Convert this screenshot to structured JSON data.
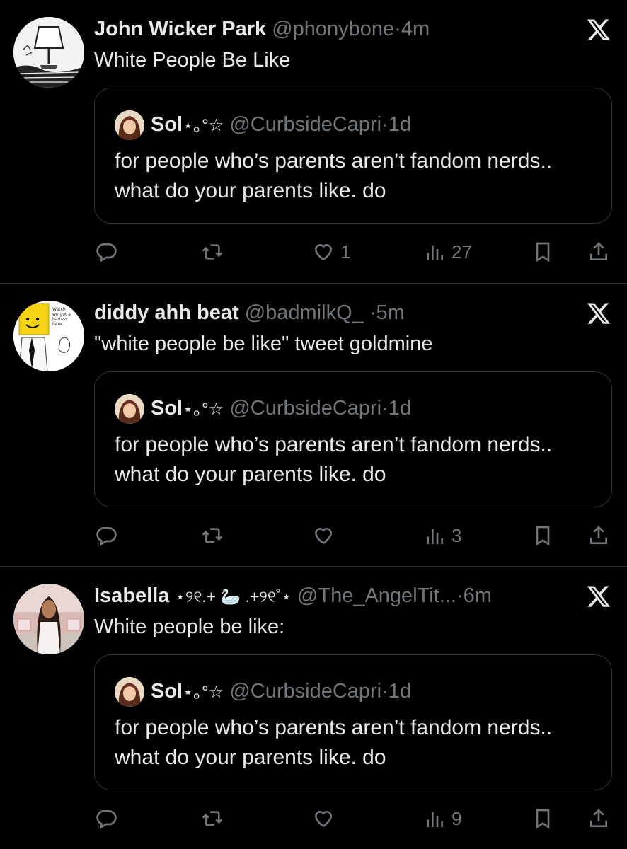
{
  "quoted": {
    "name": "Sol",
    "decoration": "⋆｡°☆",
    "handle": "@CurbsideCapri",
    "separator": "·",
    "time": "1d",
    "text": "for people who’s parents aren’t fandom nerds.. what do your parents like. do"
  },
  "tweets": [
    {
      "name": "John Wicker Park",
      "decoration": "",
      "handle": "@phonybone",
      "separator": "·",
      "time": "4m",
      "text": "White People Be Like",
      "stats": {
        "likes": "1",
        "views": "27"
      },
      "avatar_icon": "lamp-sketch-avatar"
    },
    {
      "name": "diddy ahh beat",
      "decoration": "",
      "handle": "@badmilkQ_",
      "separator": "·",
      "time": "5m",
      "text": "\"white people be like\" tweet goldmine",
      "stats": {
        "likes": "",
        "views": "3"
      },
      "avatar_icon": "roblox-noob-avatar"
    },
    {
      "name": "Isabella",
      "decoration": "⋆୨୧.+ 🦢 .+୨୧˚⋆",
      "handle": "@The_AngelTit...",
      "separator": "·",
      "time": "6m",
      "text": "White people be like:",
      "stats": {
        "likes": "",
        "views": "9"
      },
      "avatar_icon": "girl-photo-avatar"
    }
  ],
  "icons": {
    "close": "x-logo-icon",
    "reply": "reply-icon",
    "retweet": "retweet-icon",
    "like": "heart-icon",
    "views": "views-icon",
    "bookmark": "bookmark-icon",
    "share": "share-icon"
  },
  "colors": {
    "background": "#000000",
    "text": "#e7e9ea",
    "muted": "#71767b",
    "border": "#2f3336"
  }
}
